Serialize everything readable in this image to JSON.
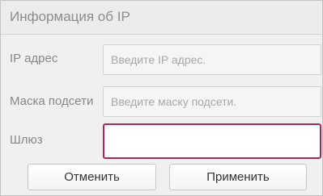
{
  "panel": {
    "title": "Информация об IP"
  },
  "form": {
    "ip": {
      "label": "IP адрес",
      "value": "",
      "placeholder": "Введите IP адрес."
    },
    "mask": {
      "label": "Маска подсети",
      "value": "",
      "placeholder": "Введите маску подсети."
    },
    "gateway": {
      "label": "Шлюз",
      "value": "",
      "placeholder": ""
    }
  },
  "buttons": {
    "cancel_label": "Отменить",
    "apply_label": "Применить"
  },
  "colors": {
    "active_border": "#a52a55",
    "header_bg": "#ececec",
    "form_bg": "#f0f0f0"
  }
}
